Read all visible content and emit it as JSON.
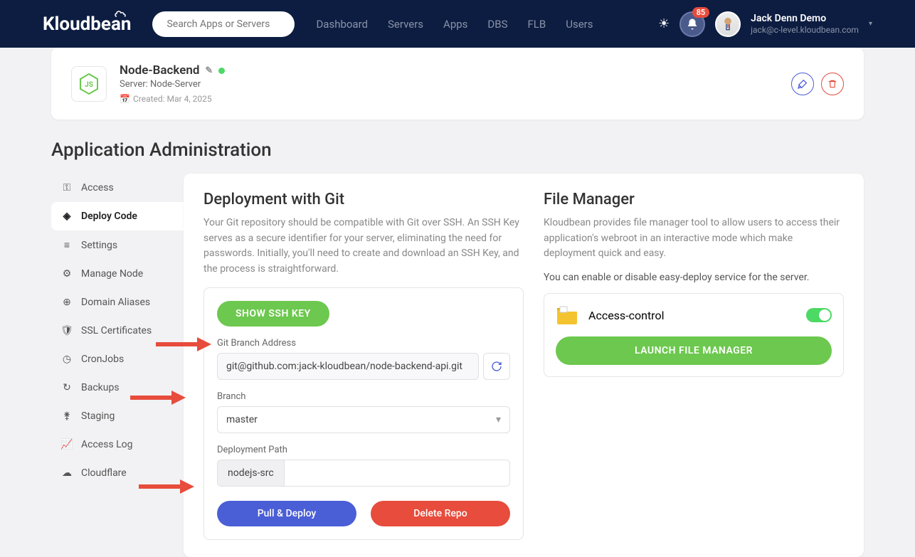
{
  "search": {
    "placeholder": "Search Apps or Servers"
  },
  "topnav": {
    "dashboard": "Dashboard",
    "servers": "Servers",
    "apps": "Apps",
    "dbs": "DBS",
    "flb": "FLB",
    "users": "Users"
  },
  "badge": "85",
  "user": {
    "name": "Jack Denn Demo",
    "email": "jack@c-level.kloudbean.com"
  },
  "app": {
    "title": "Node-Backend",
    "server": "Server: Node-Server",
    "created": "Created: Mar 4, 2025"
  },
  "page_title": "Application Administration",
  "sidebar": {
    "access": "Access",
    "deploy": "Deploy Code",
    "settings": "Settings",
    "manage": "Manage Node",
    "domain": "Domain Aliases",
    "ssl": "SSL Certificates",
    "cron": "CronJobs",
    "backups": "Backups",
    "staging": "Staging",
    "accesslog": "Access Log",
    "cloudflare": "Cloudflare"
  },
  "git": {
    "heading": "Deployment with Git",
    "desc": "Your Git repository should be compatible with Git over SSH. An SSH Key serves as a secure identifier for your server, eliminating the need for passwords. Initially, you'll need to create and download an SSH Key, and the process is straightforward.",
    "show_ssh": "SHOW SSH KEY",
    "branch_addr_label": "Git Branch Address",
    "branch_addr": "git@github.com:jack-kloudbean/node-backend-api.git",
    "branch_label": "Branch",
    "branch": "master",
    "path_label": "Deployment Path",
    "path_prefix": "nodejs-src",
    "pull_deploy": "Pull & Deploy",
    "delete_repo": "Delete Repo"
  },
  "fmgr": {
    "heading": "File Manager",
    "desc": "Kloudbean provides file manager tool to allow users to access their application's webroot in an interactive mode which make deployment quick and easy.",
    "desc2": "You can enable or disable easy-deploy service for the server.",
    "access_control": "Access-control",
    "launch": "LAUNCH FILE MANAGER"
  }
}
